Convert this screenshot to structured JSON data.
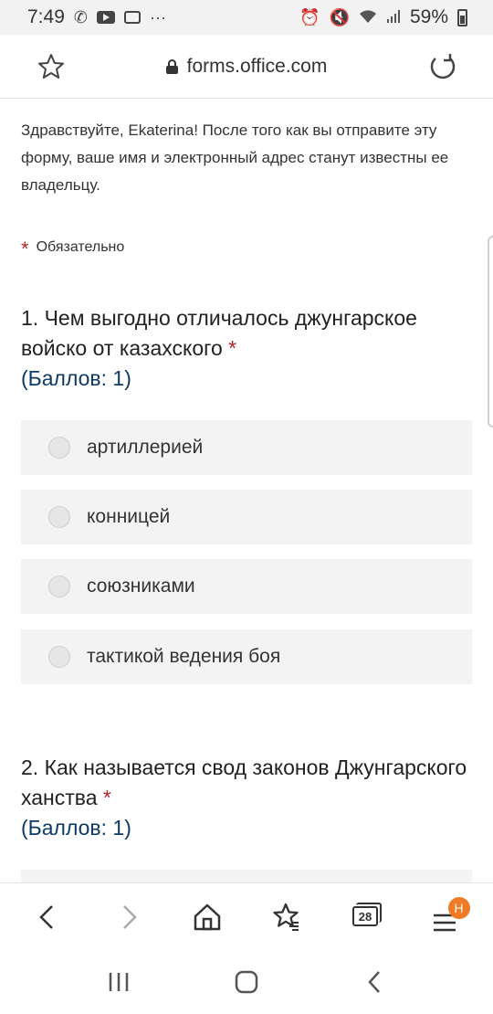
{
  "status_bar": {
    "time": "7:49",
    "dots": "···",
    "battery": "59%"
  },
  "browser": {
    "url": "forms.office.com"
  },
  "form": {
    "greeting": "Здравствуйте, Ekaterina! После того как вы отправите эту форму, ваше имя и электронный адрес станут известны ее владельцу.",
    "required_star": "*",
    "required_label": "Обязательно",
    "questions": [
      {
        "title": "1. Чем выгодно отличалось джунгарское войско от казахского",
        "star": "*",
        "points": "(Баллов: 1)",
        "options": [
          "артиллерией",
          "конницей",
          "союзниками",
          "тактикой ведения боя"
        ]
      },
      {
        "title": "2. Как называется свод законов Джунгарского ханства",
        "star": "*",
        "points": "(Баллов: 1)"
      }
    ]
  },
  "bottom_nav": {
    "tabs_count": "28",
    "menu_badge": "H"
  },
  "icons": {
    "star": "star-icon",
    "lock": "lock-icon",
    "reload": "reload-icon",
    "back": "back-arrow-icon",
    "forward": "forward-arrow-icon",
    "home": "home-icon",
    "bookmarks": "bookmarks-icon",
    "tabs": "tabs-icon",
    "menu": "menu-icon"
  },
  "colors": {
    "required": "#b0262d",
    "points": "#0d3b66",
    "option_bg": "#f3f3f3",
    "badge": "#f07b24"
  }
}
